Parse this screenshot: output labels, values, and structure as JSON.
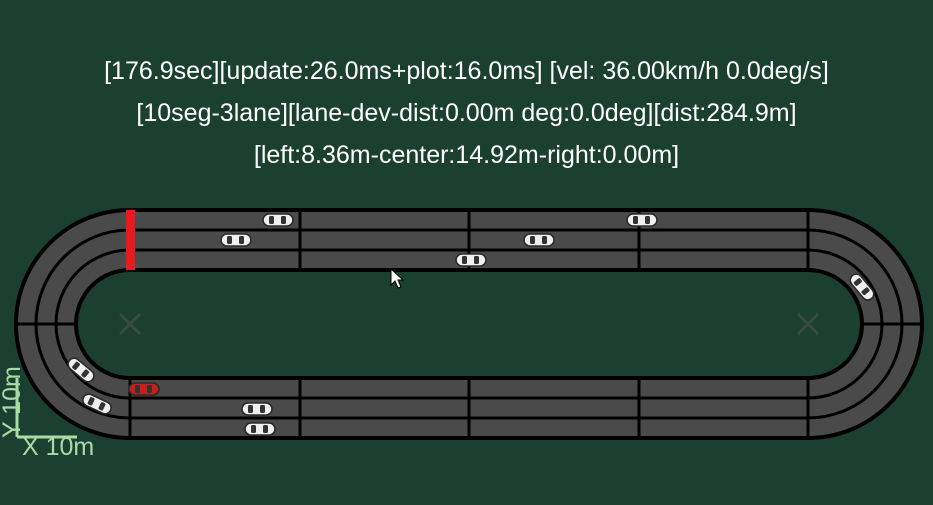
{
  "hud": {
    "line1": "[176.9sec][update:26.0ms+plot:16.0ms] [vel: 36.00km/h 0.0deg/s]",
    "line2": "[10seg-3lane][lane-dev-dist:0.00m deg:0.0deg][dist:284.9m]",
    "line3": "[left:8.36m-center:14.92m-right:0.00m]"
  },
  "scale": {
    "x_label": "X 10m",
    "y_label": "Y 10m"
  },
  "track": {
    "segments": 10,
    "lanes": 3
  },
  "colors": {
    "background": "#1b3f31",
    "road": "#4a4a4a",
    "border": "#000000",
    "finish_line": "#e8191f",
    "ego_car": "#c81e1e",
    "other_car": "#e6e6e6",
    "scale_bar": "#a9dca5"
  },
  "icons": {
    "cursor": "mouse-pointer-icon",
    "center_marker": "x-marker-icon",
    "car": "car-icon"
  }
}
